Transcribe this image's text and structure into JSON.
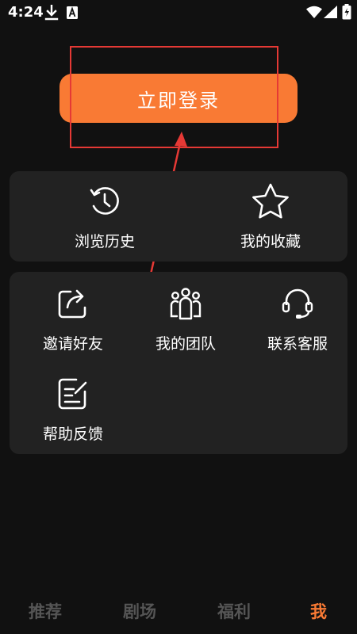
{
  "status_bar": {
    "time": "4:24",
    "icons": [
      "download-icon",
      "a-notification-icon",
      "wifi-icon",
      "signal-icon",
      "battery-icon"
    ]
  },
  "login": {
    "button_label": "立即登录"
  },
  "card_1": {
    "items": [
      {
        "label": "浏览历史",
        "icon": "clock-history-icon"
      },
      {
        "label": "我的收藏",
        "icon": "star-icon"
      }
    ]
  },
  "card_2": {
    "items": [
      {
        "label": "邀请好友",
        "icon": "share-icon"
      },
      {
        "label": "我的团队",
        "icon": "team-icon"
      },
      {
        "label": "联系客服",
        "icon": "headset-icon"
      },
      {
        "label": "帮助反馈",
        "icon": "feedback-edit-icon"
      }
    ]
  },
  "bottom_nav": {
    "tabs": [
      {
        "label": "推荐"
      },
      {
        "label": "剧场"
      },
      {
        "label": "福利"
      },
      {
        "label": "我"
      }
    ],
    "active_index": 3
  },
  "colors": {
    "background": "#111111",
    "card": "#222222",
    "accent": "#f97a34",
    "annotation": "#e53935",
    "inactive_tab": "#555555"
  }
}
